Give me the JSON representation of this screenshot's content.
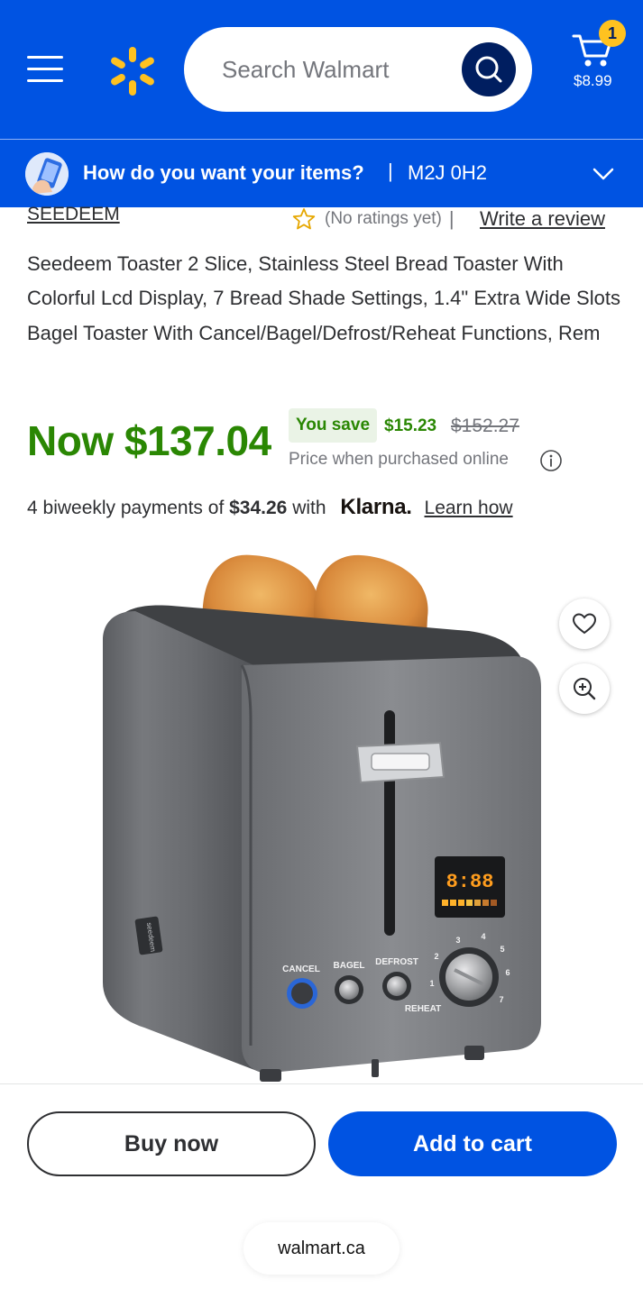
{
  "theme": {
    "brand": "#0053e2",
    "brand_dark": "#001e60",
    "spark_yellow": "#ffc220",
    "price_green": "#2a8703"
  },
  "header": {
    "menu_icon": "hamburger-menu-icon",
    "logo_icon": "walmart-spark-icon",
    "search_placeholder": "Search Walmart",
    "search_icon": "search-icon",
    "cart_icon": "cart-icon",
    "cart_count": "1",
    "cart_total": "$8.99"
  },
  "delivery": {
    "icon": "delivery-phone-icon",
    "question": "How do you want your items?",
    "separator": "|",
    "postal_code": "M2J 0H2",
    "chevron_icon": "chevron-down-icon"
  },
  "product": {
    "brand": "SEEDEEM",
    "rating_text": "(No ratings yet)",
    "rating_separator": "|",
    "write_review": "Write a review",
    "title": "Seedeem Toaster 2 Slice, Stainless Steel Bread Toaster With Colorful Lcd Display, 7 Bread Shade Settings, 1.4\" Extra Wide Slots Bagel Toaster With Cancel/Bagel/Defrost/Reheat Functions, Rem",
    "image": {
      "display": "8:88",
      "buttons": [
        "CANCEL",
        "BAGEL",
        "DEFROST"
      ],
      "reheat_label": "REHEAT",
      "dial_numbers": [
        "1",
        "2",
        "3",
        "4",
        "5",
        "6",
        "7"
      ],
      "badge": "seedeem"
    }
  },
  "price": {
    "now": "Now $137.04",
    "you_save_label": "You save",
    "save_amount": "$15.23",
    "was": "$152.27",
    "note": "Price when purchased online",
    "info_icon": "info-icon"
  },
  "klarna": {
    "prefix": "4 biweekly payments of",
    "amount": "$34.26",
    "with": "with",
    "logo": "Klarna.",
    "learn_how": "Learn how"
  },
  "image_actions": {
    "favorite_icon": "heart-icon",
    "zoom_icon": "zoom-in-icon"
  },
  "actions": {
    "buy_now": "Buy now",
    "add_to_cart": "Add to cart"
  },
  "browser": {
    "url": "walmart.ca"
  }
}
